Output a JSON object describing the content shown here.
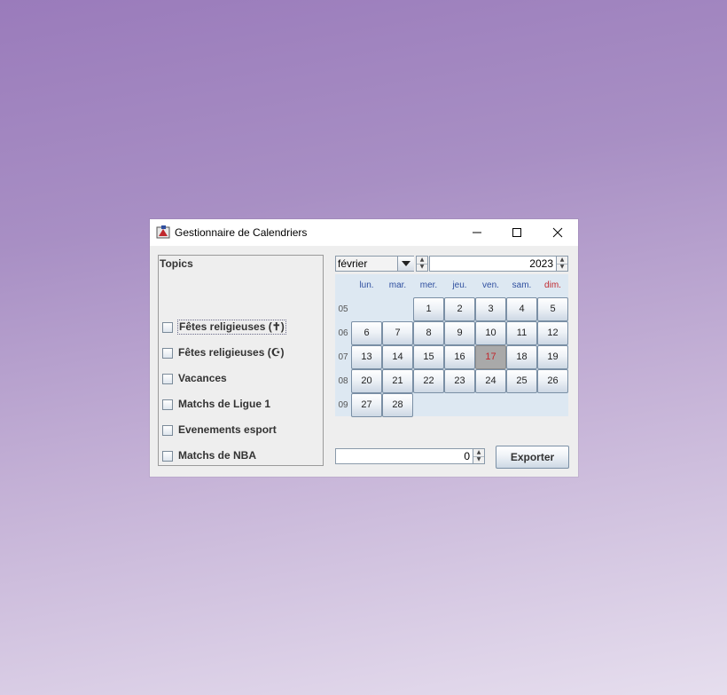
{
  "window": {
    "title": "Gestionnaire de Calendriers"
  },
  "topics": {
    "title": "Topics",
    "items": [
      {
        "label": "Fêtes religieuses (✝)",
        "checked": false,
        "focused": true
      },
      {
        "label": "Fêtes religieuses (☪)",
        "checked": false
      },
      {
        "label": "Vacances",
        "checked": false
      },
      {
        "label": "Matchs de Ligue 1",
        "checked": false
      },
      {
        "label": "Evenements esport",
        "checked": false
      },
      {
        "label": "Matchs de NBA",
        "checked": false
      }
    ]
  },
  "calendar": {
    "month": "février",
    "year": "2023",
    "weekday_headers": [
      "lun.",
      "mar.",
      "mer.",
      "jeu.",
      "ven.",
      "sam.",
      "dim."
    ],
    "weeks": [
      {
        "number": "05",
        "days": [
          "",
          "",
          "1",
          "2",
          "3",
          "4",
          "5"
        ]
      },
      {
        "number": "06",
        "days": [
          "6",
          "7",
          "8",
          "9",
          "10",
          "11",
          "12"
        ]
      },
      {
        "number": "07",
        "days": [
          "13",
          "14",
          "15",
          "16",
          "17",
          "18",
          "19"
        ]
      },
      {
        "number": "08",
        "days": [
          "20",
          "21",
          "22",
          "23",
          "24",
          "25",
          "26"
        ]
      },
      {
        "number": "09",
        "days": [
          "27",
          "28",
          "",
          "",
          "",
          "",
          ""
        ]
      }
    ],
    "today": "17"
  },
  "export": {
    "count_value": "0",
    "button_label": "Exporter"
  },
  "colors": {
    "weekday": "#2f4f9f",
    "sunday": "#c0282d",
    "today_bg": "#a9a9a9"
  }
}
